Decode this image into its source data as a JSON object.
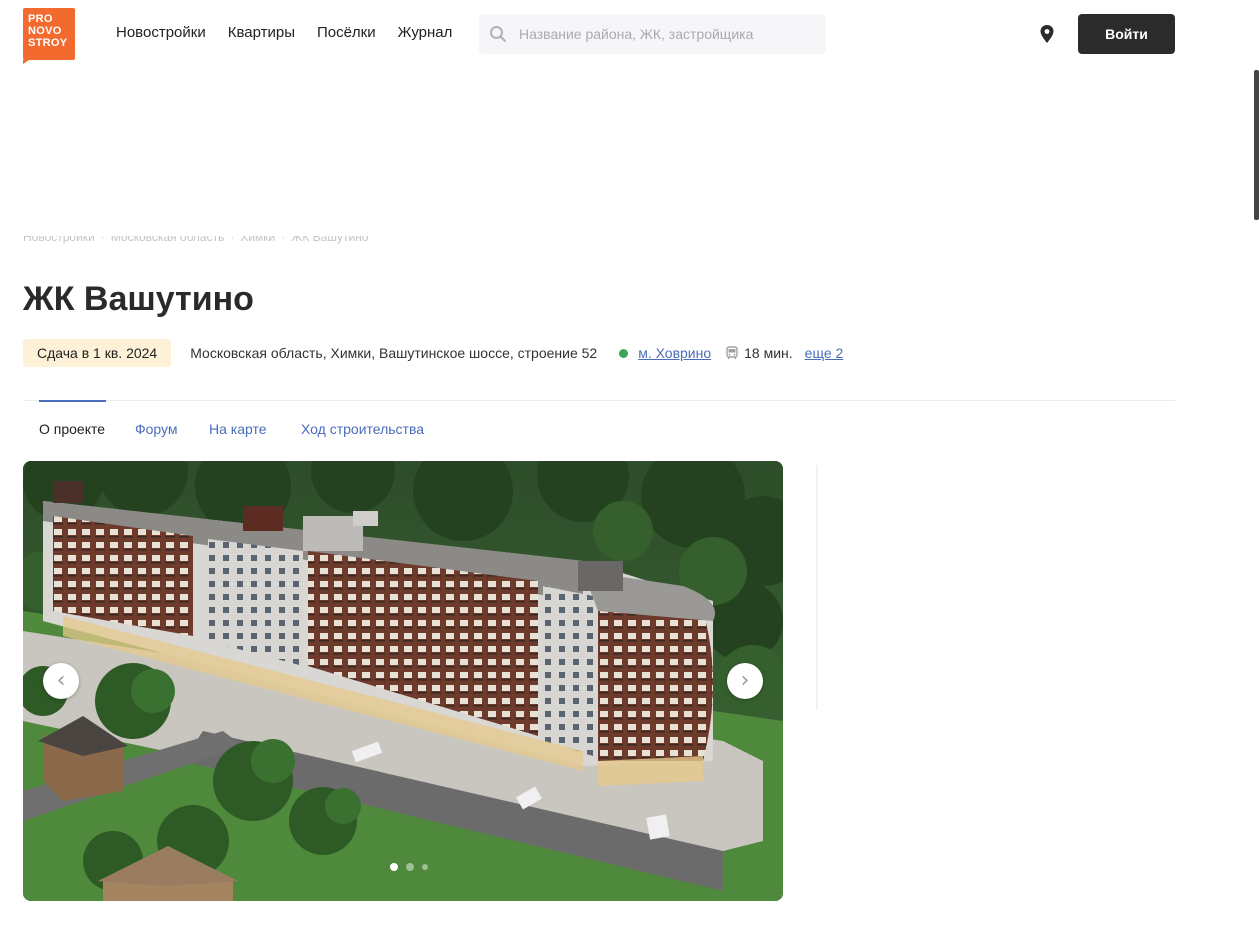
{
  "header": {
    "logo_lines": [
      "PRO",
      "NOVO",
      "STROY"
    ],
    "nav": [
      "Новостройки",
      "Квартиры",
      "Посёлки",
      "Журнал"
    ],
    "search_placeholder": "Название района, ЖК, застройщика",
    "login_label": "Войти"
  },
  "breadcrumb": [
    "Новостройки",
    "Московская область",
    "Химки",
    "ЖК Вашутино"
  ],
  "page_title": "ЖК Вашутино",
  "meta": {
    "badge": "Сдача в 1 кв. 2024",
    "address": "Московская область, Химки, Вашутинское шоссе, строение 52",
    "metro": "м. Ховрино",
    "travel_time": "18 мин.",
    "more": "еще 2",
    "metro_color": "#3ea35a"
  },
  "tabs": [
    {
      "label": "О проекте",
      "active": true
    },
    {
      "label": "Форум",
      "active": false
    },
    {
      "label": "На карте",
      "active": false
    },
    {
      "label": "Ход строительства",
      "active": false
    }
  ],
  "gallery": {
    "prev_glyph": "‹",
    "next_glyph": "›",
    "slide_count": 3,
    "active_slide": 1
  },
  "colors": {
    "brand": "#f26a2e",
    "link": "#4a6dbb",
    "badge_bg": "#fdf1d8",
    "login_bg": "#2b2b2b"
  }
}
